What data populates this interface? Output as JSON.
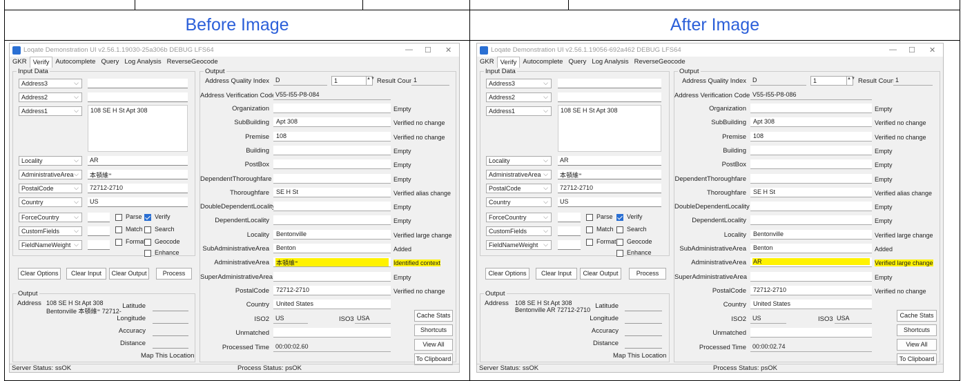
{
  "headers": {
    "before": "Before Image",
    "after": "After Image"
  },
  "shared": {
    "tabs": [
      "GKR",
      "Verify",
      "Autocomplete",
      "Query",
      "Log Analysis",
      "ReverseGeocode"
    ],
    "input_panel": "Input Data",
    "output_panel": "Output",
    "fields": [
      {
        "label": "Address3",
        "value": ""
      },
      {
        "label": "Address2",
        "value": ""
      },
      {
        "label": "Address1",
        "value": "108 SE H St Apt 308"
      },
      {
        "label": "Locality",
        "value": "AR"
      },
      {
        "label": "AdministrativeArea",
        "value": "本頓維⁼"
      },
      {
        "label": "PostalCode",
        "value": "72712-2710"
      },
      {
        "label": "Country",
        "value": "US"
      },
      {
        "label": "ForceCountry",
        "value": ""
      },
      {
        "label": "CustomFields",
        "value": ""
      },
      {
        "label": "FieldNameWeight",
        "value": ""
      }
    ],
    "checkboxes": {
      "parse": "Parse",
      "verify": "Verify",
      "match": "Match",
      "search": "Search",
      "format": "Format",
      "geocode": "Geocode",
      "enhance": "Enhance"
    },
    "buttons": {
      "clear_options": "Clear Options",
      "clear_input": "Clear Input",
      "clear_output": "Clear Output",
      "process": "Process",
      "cache_stats": "Cache Stats",
      "shortcuts": "Shortcuts",
      "view_all": "View All",
      "to_clipboard": "To Clipboard",
      "map": "Map This Location"
    },
    "bottom_output": {
      "title": "Output",
      "address_label": "Address",
      "latitude": "Latitude",
      "longitude": "Longitude",
      "accuracy": "Accuracy",
      "distance": "Distance"
    },
    "aqi_label": "Address Quality Index",
    "aqi": "D",
    "spin": "1",
    "result_count_label": "Result Count",
    "result_count": "1",
    "avc_label": "Address Verification Code",
    "iso2_label": "ISO2",
    "iso2": "US",
    "iso3_label": "ISO3",
    "iso3": "USA",
    "unmatched_label": "Unmatched",
    "processed_label": "Processed Time",
    "out_rows": [
      {
        "label": "Organization",
        "value": "",
        "status": "Empty"
      },
      {
        "label": "SubBuilding",
        "value": "Apt 308",
        "status": "Verified no change"
      },
      {
        "label": "Premise",
        "value": "108",
        "status": "Verified no change"
      },
      {
        "label": "Building",
        "value": "",
        "status": "Empty"
      },
      {
        "label": "PostBox",
        "value": "",
        "status": "Empty"
      },
      {
        "label": "DependentThoroughfare",
        "value": "",
        "status": "Empty"
      },
      {
        "label": "Thoroughfare",
        "value": "SE H St",
        "status": "Verified alias change"
      },
      {
        "label": "DoubleDependentLocality",
        "value": "",
        "status": "Empty"
      },
      {
        "label": "DependentLocality",
        "value": "",
        "status": "Empty"
      },
      {
        "label": "Locality",
        "value": "Bentonville",
        "status": "Verified large change"
      },
      {
        "label": "SubAdministrativeArea",
        "value": "Benton",
        "status": "Added"
      },
      {
        "label": "AdministrativeArea",
        "value": "",
        "status": ""
      },
      {
        "label": "SuperAdministrativeArea",
        "value": "",
        "status": "Empty"
      },
      {
        "label": "PostalCode",
        "value": "72712-2710",
        "status": "Verified no change"
      },
      {
        "label": "Country",
        "value": "United States",
        "status": ""
      }
    ],
    "status_server": "Server Status: ssOK",
    "status_process": "Process Status: psOK",
    "window_controls": {
      "min": "—",
      "max": "☐",
      "close": "✕"
    }
  },
  "before": {
    "title": "Loqate Demonstration UI v2.56.1.19030-25a306b  DEBUG  LFS64",
    "avc": "V55-I55-P8-084",
    "admin_value": "本頓維⁼",
    "admin_status": "Identified context",
    "processed": "00:00:02.60",
    "address_line1": "108 SE H St Apt 308",
    "address_line2": "Bentonville 本頓維⁼ 72712-"
  },
  "after": {
    "title": "Loqate Demonstration UI v2.56.1.19056-692a462  DEBUG  LFS64",
    "avc": "V55-I55-P8-086",
    "admin_value": "AR",
    "admin_status": "Verified large change",
    "processed": "00:00:02.74",
    "address_line1": "108 SE H St Apt 308",
    "address_line2": "Bentonville AR 72712-2710"
  }
}
